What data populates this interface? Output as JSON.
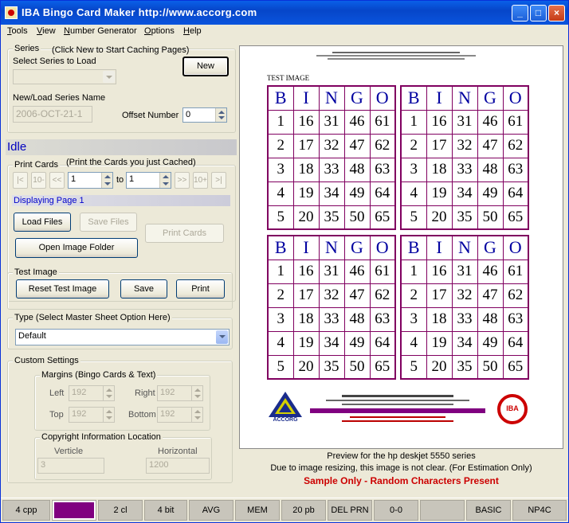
{
  "window": {
    "title": "IBA Bingo Card Maker  http://www.accorg.com"
  },
  "menu": [
    "Tools",
    "View",
    "Number Generator",
    "Options",
    "Help"
  ],
  "series": {
    "group_label": "Series",
    "hint": "(Click New to Start Caching Pages)",
    "select_label": "Select Series to Load",
    "select_value": "",
    "new_button": "New",
    "name_label": "New/Load Series Name",
    "name_value": "2006-OCT-21-1",
    "offset_label": "Offset Number",
    "offset_value": "0"
  },
  "status_text": "Idle",
  "print_cards": {
    "group_label": "Print Cards",
    "hint": "(Print the Cards you just Cached)",
    "nav_first": "|<",
    "nav_back10": "10-",
    "nav_prev": "<<",
    "from_value": "1",
    "to_label": "to",
    "to_value": "1",
    "nav_next": ">>",
    "nav_fwd10": "10+",
    "nav_last": ">|",
    "displaying": "Displaying Page 1",
    "load_files": "Load Files",
    "save_files": "Save Files",
    "print_cards": "Print Cards",
    "open_folder": "Open Image Folder"
  },
  "test_image": {
    "group_label": "Test Image",
    "reset": "Reset Test Image",
    "save": "Save",
    "print": "Print"
  },
  "type": {
    "group_label": "Type  (Select Master Sheet Option Here)",
    "value": "Default"
  },
  "custom": {
    "group_label": "Custom Settings",
    "margins_label": "Margins (Bingo Cards  & Text)",
    "left_label": "Left",
    "left_value": "192",
    "right_label": "Right",
    "right_value": "192",
    "top_label": "Top",
    "top_value": "192",
    "bottom_label": "Bottom",
    "bottom_value": "192",
    "copyright_label": "Copyright Information Location",
    "verticle_label": "Verticle",
    "verticle_value": "3",
    "horizontal_label": "Horizontal",
    "horizontal_value": "1200"
  },
  "preview": {
    "test_image_label": "TEST IMAGE",
    "bingo_letters": [
      "B",
      "I",
      "N",
      "G",
      "O"
    ],
    "card_rows": [
      [
        "1",
        "16",
        "31",
        "46",
        "61"
      ],
      [
        "2",
        "17",
        "32",
        "47",
        "62"
      ],
      [
        "3",
        "18",
        "33",
        "48",
        "63"
      ],
      [
        "4",
        "19",
        "34",
        "49",
        "64"
      ],
      [
        "5",
        "20",
        "35",
        "50",
        "65"
      ]
    ],
    "logo_left": "ACCORG",
    "logo_right": "IBA"
  },
  "notes": {
    "line1": "Preview for the hp deskjet 5550 series",
    "line2": "Due to image resizing, this image is not clear.  (For Estimation Only)",
    "line3": "Sample Only - Random Characters Present"
  },
  "statusbar": [
    "4 cpp",
    "",
    "2 cl",
    "4 bit",
    "AVG",
    "MEM",
    "20 pb",
    "DEL PRN",
    "0-0",
    "",
    "BASIC",
    "NP4C"
  ],
  "colors": {
    "swatch": "#800080",
    "warning": "#cc0000",
    "card_border": "#800060",
    "header_letter": "#0000a0"
  }
}
